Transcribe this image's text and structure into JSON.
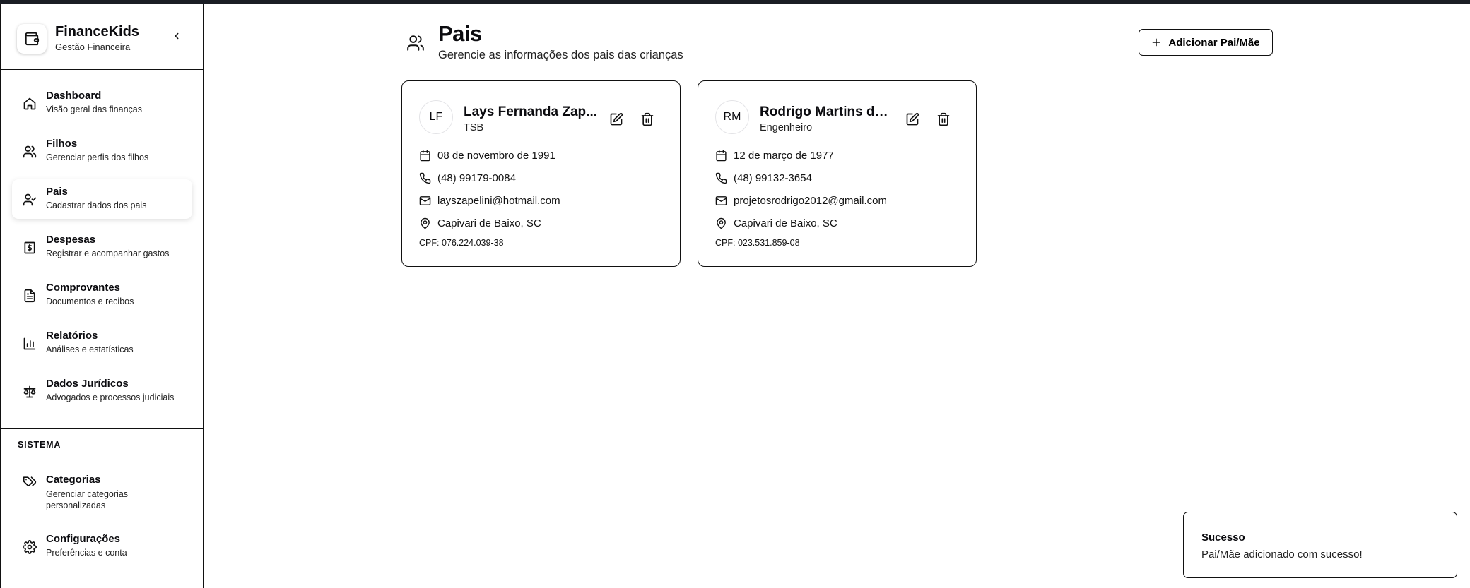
{
  "app": {
    "title": "FinanceKids",
    "subtitle": "Gestão Financeira"
  },
  "sidebar": {
    "items": [
      {
        "label": "Dashboard",
        "desc": "Visão geral das finanças",
        "icon": "home-icon"
      },
      {
        "label": "Filhos",
        "desc": "Gerenciar perfis dos filhos",
        "icon": "users-icon"
      },
      {
        "label": "Pais",
        "desc": "Cadastrar dados dos pais",
        "icon": "user-check-icon",
        "active": true
      },
      {
        "label": "Despesas",
        "desc": "Registrar e acompanhar gastos",
        "icon": "dollar-receipt-icon"
      },
      {
        "label": "Comprovantes",
        "desc": "Documentos e recibos",
        "icon": "file-text-icon"
      },
      {
        "label": "Relatórios",
        "desc": "Análises e estatísticas",
        "icon": "bar-chart-icon"
      },
      {
        "label": "Dados Jurídicos",
        "desc": "Advogados e processos judiciais",
        "icon": "scale-icon"
      }
    ],
    "section_title": "SISTEMA",
    "system_items": [
      {
        "label": "Categorias",
        "desc": "Gerenciar categorias personalizadas",
        "icon": "tags-icon"
      },
      {
        "label": "Configurações",
        "desc": "Preferências e conta",
        "icon": "gear-icon"
      }
    ]
  },
  "header": {
    "title": "Pais",
    "subtitle": "Gerencie as informações dos pais das crianças",
    "add_button": "Adicionar Pai/Mãe"
  },
  "parents": [
    {
      "initials": "LF",
      "name": "Lays Fernanda Zap...",
      "role": "TSB",
      "birth": "08 de novembro de 1991",
      "phone": "(48) 99179-0084",
      "email": "layszapelini@hotmail.com",
      "location": "Capivari de Baixo, SC",
      "cpf": "CPF: 076.224.039-38"
    },
    {
      "initials": "RM",
      "name": "Rodrigo Martins da ...",
      "role": "Engenheiro",
      "birth": "12 de março de 1977",
      "phone": "(48) 99132-3654",
      "email": "projetosrodrigo2012@gmail.com",
      "location": "Capivari de Baixo, SC",
      "cpf": "CPF: 023.531.859-08"
    }
  ],
  "toast": {
    "title": "Sucesso",
    "message": "Pai/Mãe adicionado com sucesso!"
  }
}
